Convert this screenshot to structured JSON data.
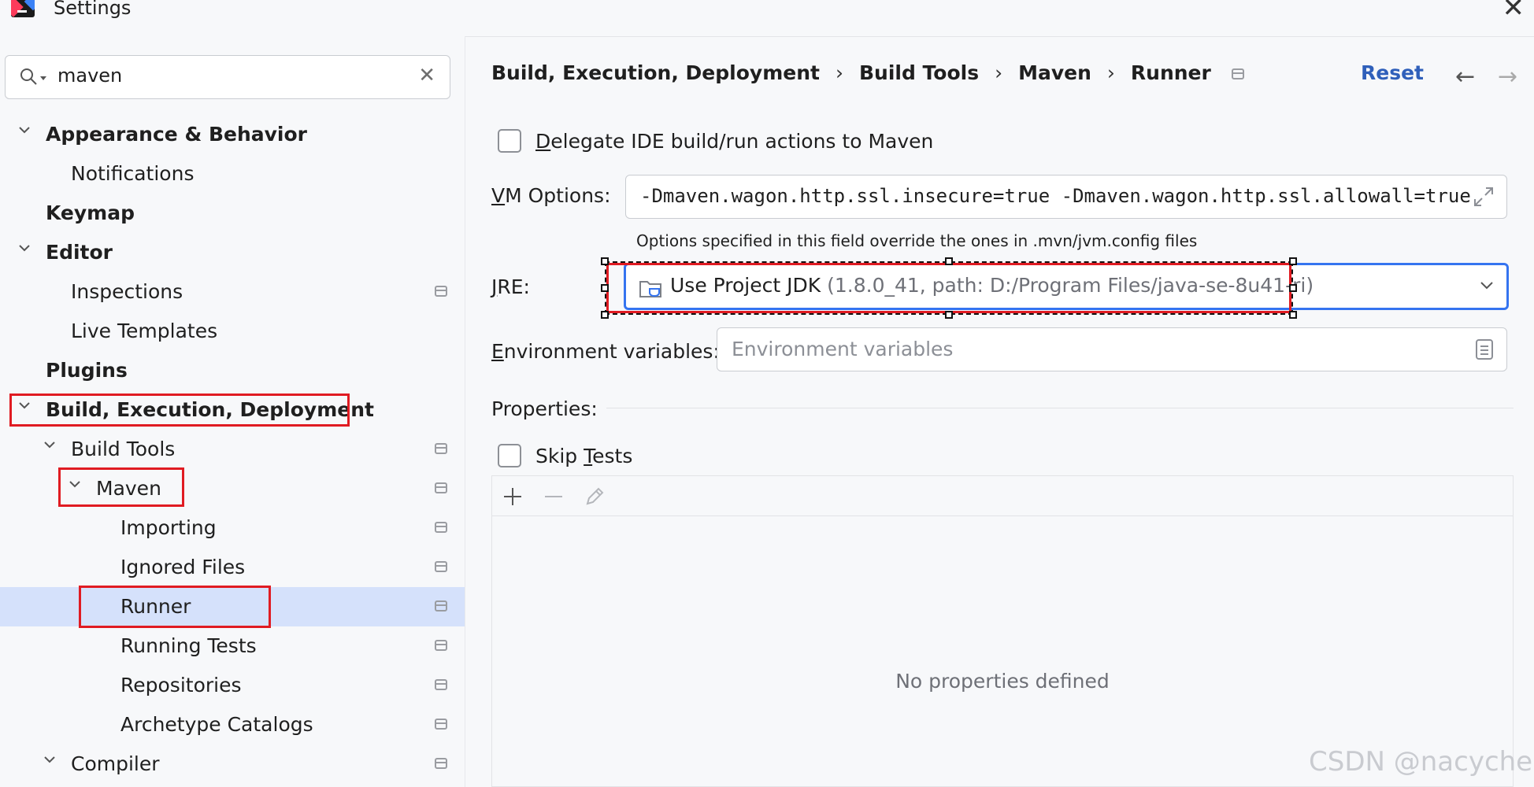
{
  "window": {
    "title": "Settings"
  },
  "search": {
    "value": "maven"
  },
  "tree": {
    "appearance": "Appearance & Behavior",
    "notifications": "Notifications",
    "keymap": "Keymap",
    "editor": "Editor",
    "inspections": "Inspections",
    "live_templates": "Live Templates",
    "plugins": "Plugins",
    "build": "Build, Execution, Deployment",
    "build_tools": "Build Tools",
    "maven": "Maven",
    "importing": "Importing",
    "ignored_files": "Ignored Files",
    "runner": "Runner",
    "running_tests": "Running Tests",
    "repositories": "Repositories",
    "archetype_catalogs": "Archetype Catalogs",
    "compiler": "Compiler"
  },
  "breadcrumb": {
    "c1": "Build, Execution, Deployment",
    "c2": "Build Tools",
    "c3": "Maven",
    "c4": "Runner",
    "sep": "›"
  },
  "header": {
    "reset": "Reset"
  },
  "runner": {
    "delegate": {
      "pre": "",
      "key": "D",
      "post": "elegate IDE build/run actions to Maven"
    },
    "vm_label": {
      "key": "V",
      "post": "M Options:"
    },
    "vm_value": "-Dmaven.wagon.http.ssl.insecure=true -Dmaven.wagon.http.ssl.allowall=true",
    "vm_hint": "Options specified in this field override the ones in .mvn/jvm.config files",
    "jre_label": {
      "key": "J",
      "post": "RE:"
    },
    "jre_main": "Use Project JDK",
    "jre_detail": "(1.8.0_41, path: D:/Program Files/java-se-8u41-ri)",
    "env_label": {
      "key": "E",
      "post": "nvironment variables:"
    },
    "env_placeholder": "Environment variables",
    "properties_label": "Properties:",
    "skip_tests": {
      "pre": "Skip ",
      "key": "T",
      "post": "ests"
    },
    "empty_text": "No properties defined"
  },
  "watermark": "CSDN @nacycher",
  "colors": {
    "accent": "#3574f0",
    "reset_link": "#2f5fba",
    "annotation_red": "#e01b22",
    "selection_bg": "#d5e1fb"
  }
}
